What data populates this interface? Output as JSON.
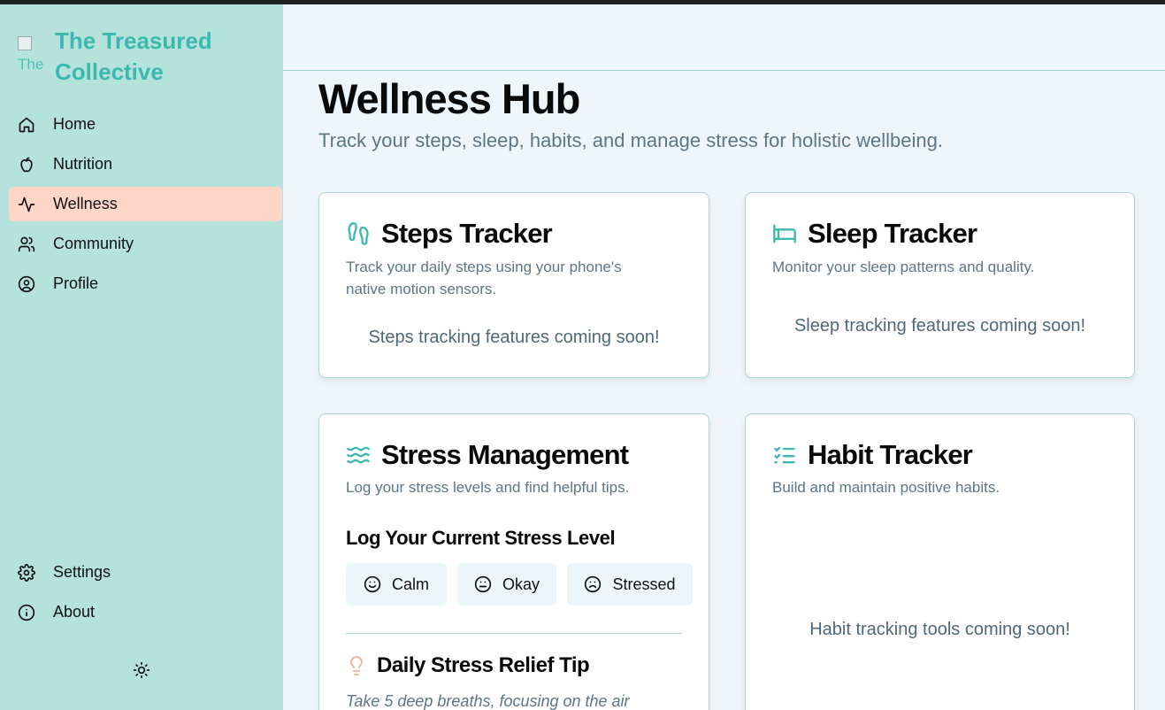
{
  "app": {
    "name": "The Treasured Collective",
    "logo_alt": "The"
  },
  "sidebar": {
    "nav_top": [
      {
        "label": "Home",
        "icon": "home-icon"
      },
      {
        "label": "Nutrition",
        "icon": "apple-icon"
      },
      {
        "label": "Wellness",
        "icon": "activity-icon",
        "active": true
      },
      {
        "label": "Community",
        "icon": "users-icon"
      },
      {
        "label": "Profile",
        "icon": "user-circle-icon"
      }
    ],
    "nav_bottom": [
      {
        "label": "Settings",
        "icon": "gear-icon"
      },
      {
        "label": "About",
        "icon": "info-icon"
      }
    ],
    "theme_toggle_icon": "sun-icon"
  },
  "page": {
    "title": "Wellness Hub",
    "subtitle": "Track your steps, sleep, habits, and manage stress for holistic wellbeing."
  },
  "cards": {
    "steps": {
      "icon": "footprints-icon",
      "title": "Steps Tracker",
      "desc_line1": "Track your daily steps using your phone's",
      "desc_line2": "native motion sensors.",
      "soon": "Steps tracking features coming soon!"
    },
    "sleep": {
      "icon": "bed-icon",
      "title": "Sleep Tracker",
      "desc": "Monitor your sleep patterns and quality.",
      "soon": "Sleep tracking features coming soon!"
    },
    "stress": {
      "icon": "waves-icon",
      "title": "Stress Management",
      "desc": "Log your stress levels and find helpful tips.",
      "log_heading": "Log Your Current Stress Level",
      "moods": [
        {
          "label": "Calm",
          "icon": "smile-icon"
        },
        {
          "label": "Okay",
          "icon": "meh-icon"
        },
        {
          "label": "Stressed",
          "icon": "frown-icon"
        }
      ],
      "tip_icon": "lightbulb-icon",
      "tip_title": "Daily Stress Relief Tip",
      "tip_text": "Take 5 deep breaths, focusing on the air"
    },
    "habit": {
      "icon": "list-checks-icon",
      "title": "Habit Tracker",
      "desc": "Build and maintain positive habits.",
      "soon": "Habit tracking tools coming soon!"
    }
  },
  "colors": {
    "accent": "#3cb8ae",
    "sidebar_bg": "#b5e3dc",
    "active_nav": "#fdd6c7",
    "tip_icon": "#f8b69d"
  }
}
